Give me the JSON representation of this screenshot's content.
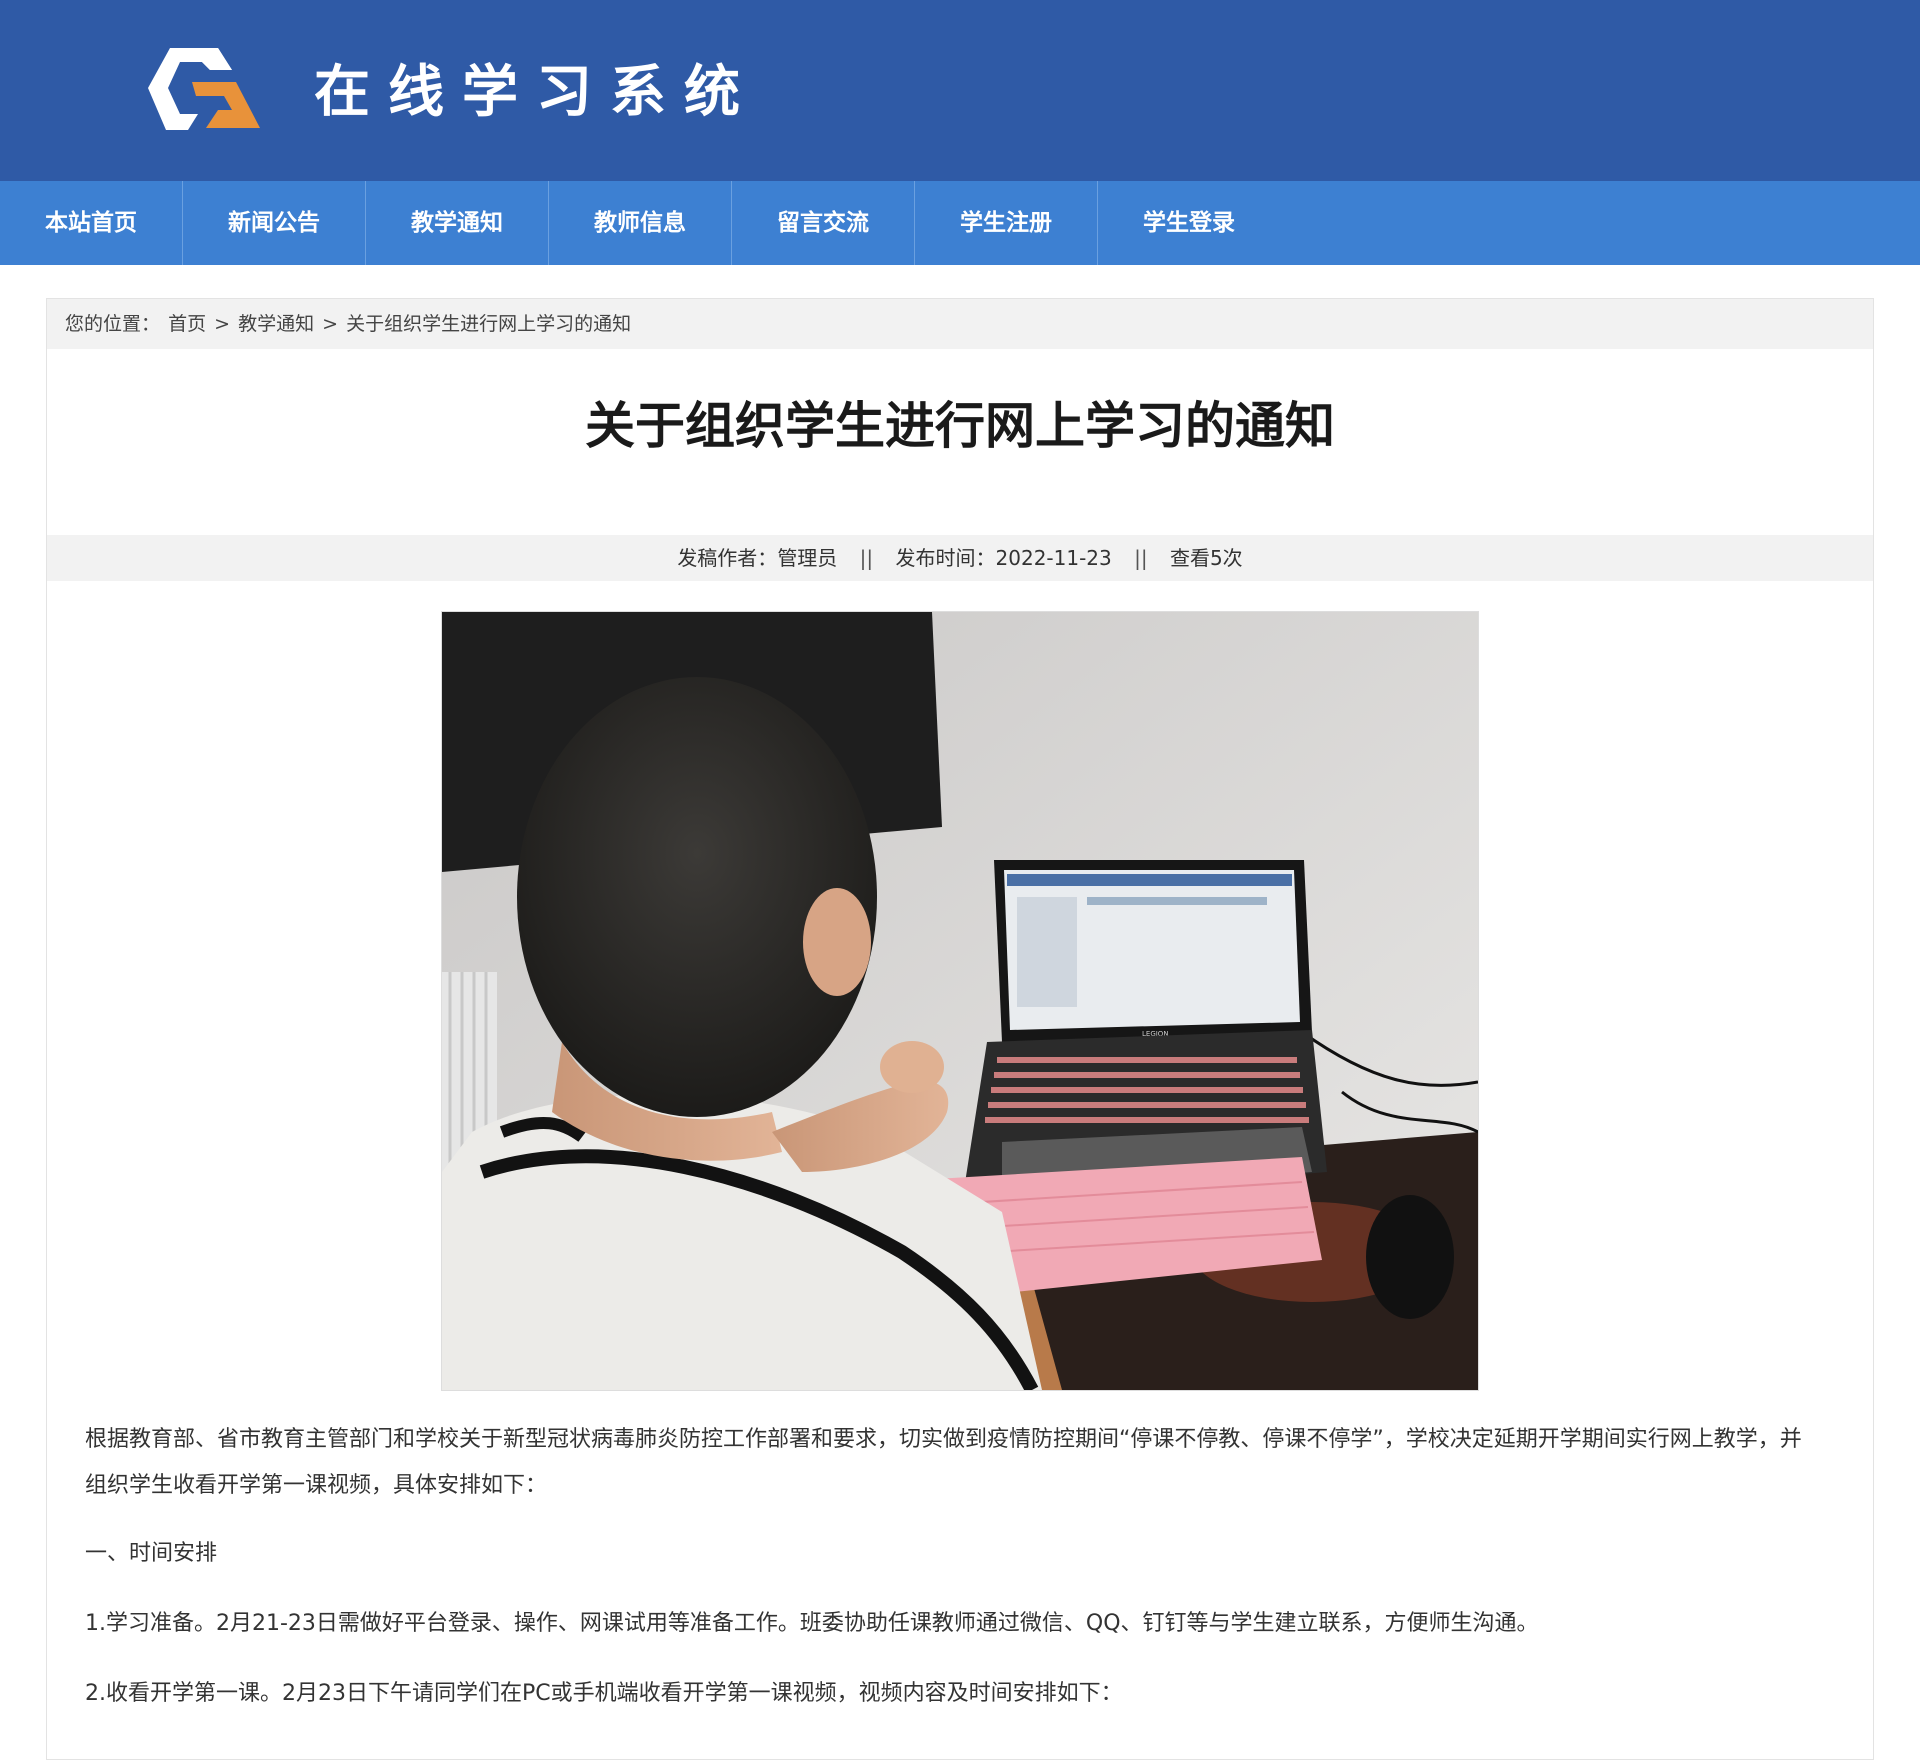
{
  "header": {
    "site_title": "在线学习系统",
    "logo_icon": "logo-icon",
    "colors": {
      "header_bg": "#2f5aa6",
      "nav_bg": "#3d80d2",
      "logo_orange": "#e8923a",
      "logo_white": "#ffffff"
    }
  },
  "nav": {
    "items": [
      {
        "label": "本站首页"
      },
      {
        "label": "新闻公告"
      },
      {
        "label": "教学通知"
      },
      {
        "label": "教师信息"
      },
      {
        "label": "留言交流"
      },
      {
        "label": "学生注册"
      },
      {
        "label": "学生登录"
      }
    ]
  },
  "breadcrumb": {
    "prefix": "您的位置：",
    "home": "首页",
    "sep": ">",
    "category": "教学通知",
    "current": "关于组织学生进行网上学习的通知"
  },
  "article": {
    "title": "关于组织学生进行网上学习的通知",
    "meta": {
      "author_label": "发稿作者：",
      "author": "管理员",
      "divider": "||",
      "date_label": "发布时间：",
      "date": "2022-11-23",
      "views": "查看5次"
    },
    "laptop_brand": "LEGION",
    "paragraphs": [
      "根据教育部、省市教育主管部门和学校关于新型冠状病毒肺炎防控工作部署和要求，切实做到疫情防控期间“停课不停教、停课不停学”，学校决定延期开学期间实行网上教学，并组织学生收看开学第一课视频，具体安排如下：",
      "一、时间安排",
      "1.学习准备。2月21-23日需做好平台登录、操作、网课试用等准备工作。班委协助任课教师通过微信、QQ、钉钉等与学生建立联系，方便师生沟通。",
      "2.收看开学第一课。2月23日下午请同学们在PC或手机端收看开学第一课视频，视频内容及时间安排如下："
    ]
  }
}
